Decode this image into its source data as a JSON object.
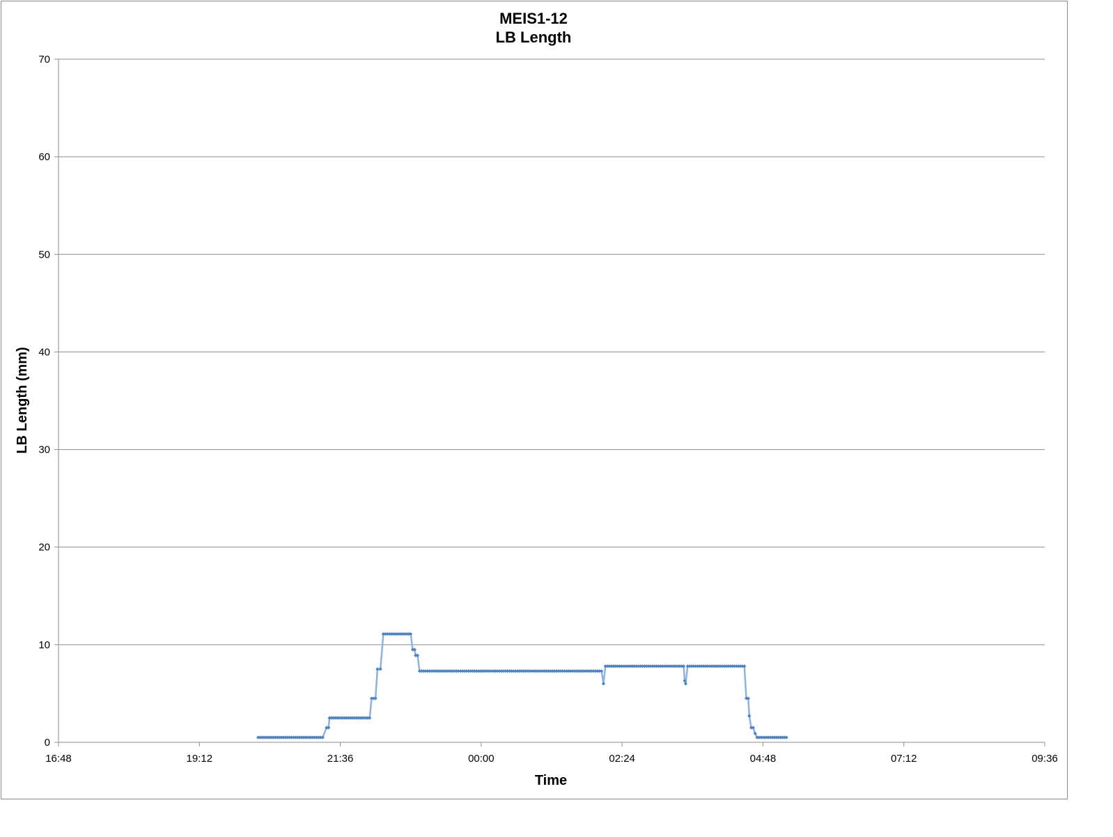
{
  "chart_data": {
    "type": "line",
    "title": "MEIS1-12",
    "subtitle": "LB Length",
    "xlabel": "Time",
    "ylabel": "LB Length (mm)",
    "x_tick_labels": [
      "16:48",
      "19:12",
      "21:36",
      "00:00",
      "02:24",
      "04:48",
      "07:12",
      "09:36"
    ],
    "x_ticks_hours": [
      0,
      2.4,
      4.8,
      7.2,
      9.6,
      12.0,
      14.4,
      16.8
    ],
    "x_range_hours": [
      0,
      16.8
    ],
    "x_origin": "16:48",
    "y_ticks": [
      0,
      10,
      20,
      30,
      40,
      50,
      60,
      70
    ],
    "ylim": [
      0,
      70
    ],
    "grid": "horizontal",
    "legend": "none",
    "series": [
      {
        "color": "#4f81bd",
        "line_color": "#8db3e2",
        "segments": [
          {
            "x_start": "20:12",
            "x_end": "21:18",
            "y": 0.5
          },
          {
            "x_start": "21:22",
            "x_end": "21:24",
            "y": 1.5
          },
          {
            "x_start": "21:25",
            "x_end": "22:06",
            "y": 2.5
          },
          {
            "x_start": "22:08",
            "x_end": "22:12",
            "y": 4.5
          },
          {
            "x_start": "22:14",
            "x_end": "22:17",
            "y": 7.5
          },
          {
            "x_start": "22:20",
            "x_end": "22:48",
            "y": 11.1
          },
          {
            "x_start": "22:50",
            "x_end": "22:52",
            "y": 9.5
          },
          {
            "x_start": "22:53",
            "x_end": "22:55",
            "y": 8.9
          },
          {
            "x_start": "22:57",
            "x_end": "02:03",
            "y": 7.3
          },
          {
            "x_start": "02:05",
            "x_end": "02:05",
            "y": 6.0
          },
          {
            "x_start": "02:07",
            "x_end": "03:27",
            "y": 7.8
          },
          {
            "x_start": "03:28",
            "x_end": "03:28",
            "y": 6.3
          },
          {
            "x_start": "03:29",
            "x_end": "03:29",
            "y": 6.0
          },
          {
            "x_start": "03:31",
            "x_end": "04:29",
            "y": 7.8
          },
          {
            "x_start": "04:31",
            "x_end": "04:33",
            "y": 4.5
          },
          {
            "x_start": "04:34",
            "x_end": "04:35",
            "y": 2.7
          },
          {
            "x_start": "04:36",
            "x_end": "04:38",
            "y": 1.5
          },
          {
            "x_start": "04:40",
            "x_end": "04:41",
            "y": 0.9
          },
          {
            "x_start": "04:42",
            "x_end": "05:12",
            "y": 0.5
          }
        ]
      }
    ]
  }
}
